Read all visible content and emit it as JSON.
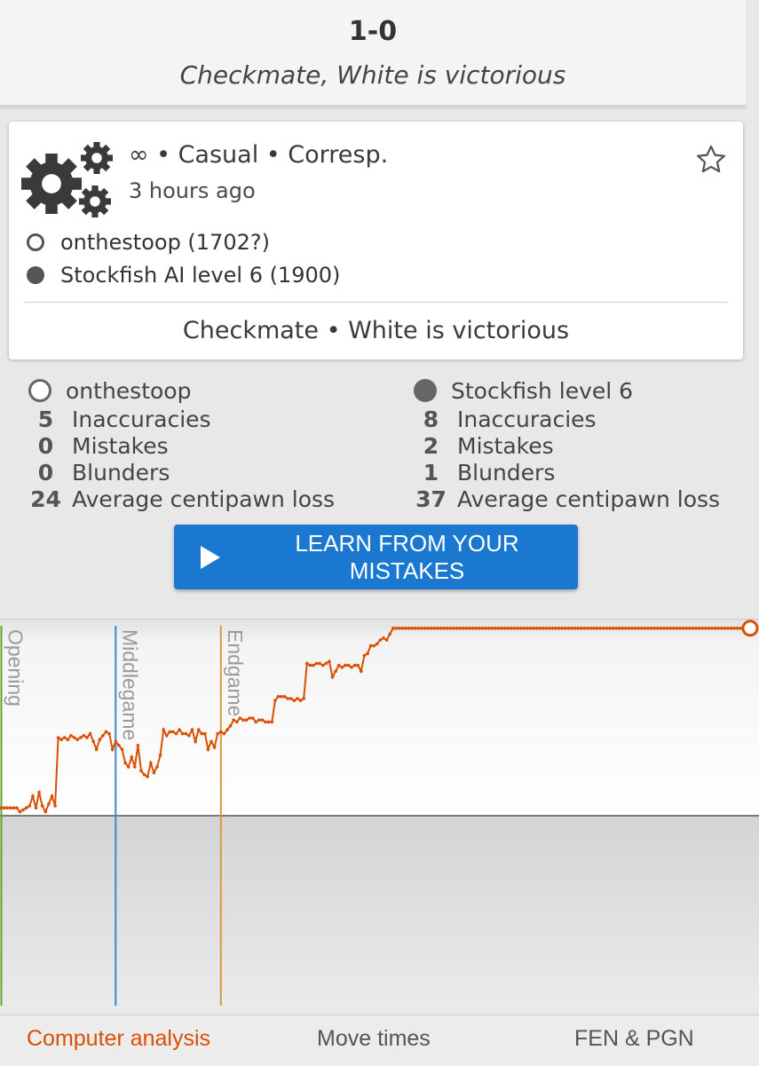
{
  "result": {
    "score": "1-0",
    "status": "Checkmate, White is victorious"
  },
  "game": {
    "meta": "∞ • Casual • Corresp.",
    "time_ago": "3 hours ago",
    "white_player": "onthestoop (1702?)",
    "black_player": "Stockfish AI level 6 (1900)",
    "status": "Checkmate • White is victorious",
    "icons": {
      "type": "gears-icon",
      "bookmark": "star-icon"
    }
  },
  "stats": {
    "white": {
      "name": "onthestoop",
      "inaccuracies": "5",
      "mistakes": "0",
      "blunders": "0",
      "acpl": "24"
    },
    "black": {
      "name": "Stockfish level 6",
      "inaccuracies": "8",
      "mistakes": "2",
      "blunders": "1",
      "acpl": "37"
    },
    "labels": {
      "inaccuracies": "Inaccuracies",
      "mistakes": "Mistakes",
      "blunders": "Blunders",
      "acpl": "Average centipawn loss"
    }
  },
  "learn_button": {
    "label": "LEARN FROM YOUR MISTAKES",
    "color": "#1b78d0"
  },
  "chart_data": {
    "type": "line",
    "title": "",
    "xlabel": "",
    "ylabel": "",
    "ylim": [
      -1,
      1
    ],
    "grid": false,
    "color": "#d85000",
    "phases": [
      {
        "label": "Opening",
        "ply": 0,
        "color": "#5fa530"
      },
      {
        "label": "Middlegame",
        "ply": 36,
        "color": "#3a8ac8"
      },
      {
        "label": "Endgame",
        "ply": 69,
        "color": "#d89a3a"
      }
    ],
    "series": [
      {
        "values": [
          0.04,
          0.04,
          0.04,
          0.04,
          0.04,
          0.04,
          0.02,
          0.03,
          0.04,
          0.05,
          0.1,
          0.04,
          0.12,
          0.05,
          0.02,
          0.06,
          0.1,
          0.05,
          0.4,
          0.39,
          0.4,
          0.39,
          0.41,
          0.4,
          0.39,
          0.4,
          0.41,
          0.4,
          0.42,
          0.38,
          0.34,
          0.39,
          0.41,
          0.43,
          0.42,
          0.34,
          0.38,
          0.36,
          0.34,
          0.27,
          0.25,
          0.3,
          0.25,
          0.36,
          0.23,
          0.21,
          0.2,
          0.27,
          0.22,
          0.25,
          0.31,
          0.44,
          0.41,
          0.43,
          0.43,
          0.42,
          0.44,
          0.42,
          0.42,
          0.41,
          0.44,
          0.38,
          0.44,
          0.42,
          0.42,
          0.34,
          0.38,
          0.35,
          0.42,
          0.43,
          0.42,
          0.44,
          0.46,
          0.49,
          0.48,
          0.5,
          0.49,
          0.49,
          0.5,
          0.5,
          0.48,
          0.49,
          0.49,
          0.48,
          0.48,
          0.48,
          0.59,
          0.61,
          0.61,
          0.61,
          0.6,
          0.6,
          0.59,
          0.6,
          0.59,
          0.6,
          0.78,
          0.77,
          0.77,
          0.78,
          0.78,
          0.77,
          0.78,
          0.79,
          0.71,
          0.74,
          0.77,
          0.76,
          0.77,
          0.77,
          0.76,
          0.77,
          0.77,
          0.74,
          0.82,
          0.83,
          0.87,
          0.87,
          0.88,
          0.9,
          0.91,
          0.9,
          0.93,
          0.96,
          0.96,
          0.96,
          0.96,
          0.96,
          0.96,
          0.96,
          0.96,
          0.96,
          0.96,
          0.96,
          0.96,
          0.96,
          0.96,
          0.96,
          0.96,
          0.96,
          0.96,
          0.96,
          0.96,
          0.96,
          0.96,
          0.96,
          0.96,
          0.96,
          0.96,
          0.96,
          0.96,
          0.96,
          0.96,
          0.96,
          0.96,
          0.96,
          0.96,
          0.96,
          0.96,
          0.96,
          0.96,
          0.96,
          0.96,
          0.96,
          0.96,
          0.96,
          0.96,
          0.96,
          0.96,
          0.96,
          0.96,
          0.96,
          0.96,
          0.96,
          0.96,
          0.96,
          0.96,
          0.96,
          0.96,
          0.96,
          0.96,
          0.96,
          0.96,
          0.96,
          0.96,
          0.96,
          0.96,
          0.96,
          0.96,
          0.96,
          0.96,
          0.96,
          0.96,
          0.96,
          0.96,
          0.96,
          0.96,
          0.96,
          0.96,
          0.96,
          0.96,
          0.96,
          0.96,
          0.96,
          0.96,
          0.96,
          0.96,
          0.96,
          0.96,
          0.96,
          0.96,
          0.96,
          0.96,
          0.96,
          0.96,
          0.96,
          0.96,
          0.96,
          0.96,
          0.96,
          0.96,
          0.96,
          0.96,
          0.96,
          0.96,
          0.96,
          0.96,
          0.96,
          0.96,
          0.96,
          0.96,
          0.96,
          0.96,
          0.96,
          0.96,
          0.96
        ]
      }
    ]
  },
  "tabs": [
    {
      "label": "Computer analysis",
      "active": true
    },
    {
      "label": "Move times",
      "active": false
    },
    {
      "label": "FEN & PGN",
      "active": false
    }
  ]
}
